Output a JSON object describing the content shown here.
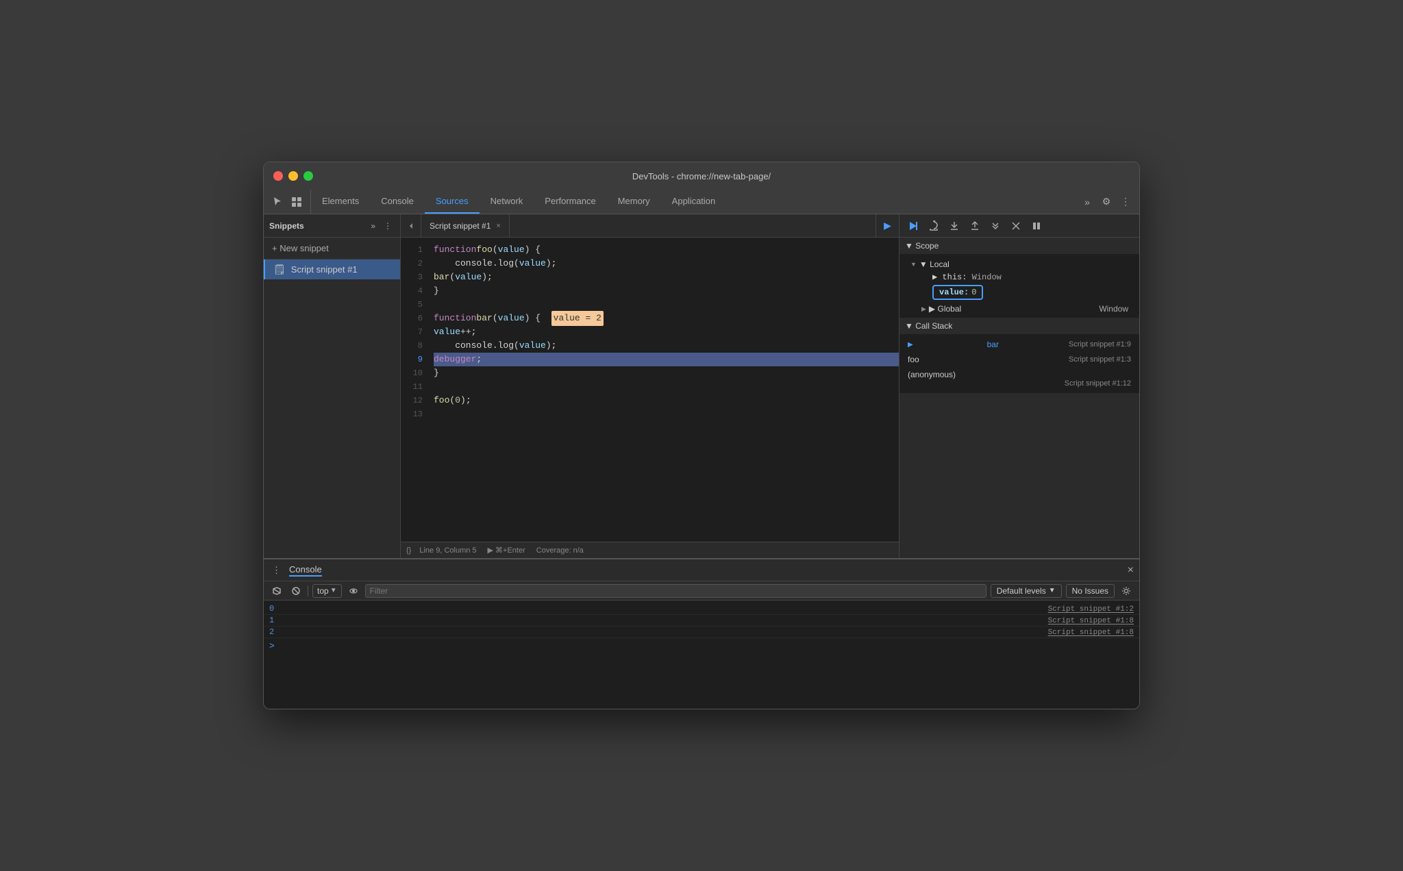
{
  "window": {
    "title": "DevTools - chrome://new-tab-page/"
  },
  "traffic_lights": {
    "red": "close",
    "yellow": "minimize",
    "green": "maximize"
  },
  "tabs": {
    "items": [
      {
        "label": "Elements",
        "active": false
      },
      {
        "label": "Console",
        "active": false
      },
      {
        "label": "Sources",
        "active": true
      },
      {
        "label": "Network",
        "active": false
      },
      {
        "label": "Performance",
        "active": false
      },
      {
        "label": "Memory",
        "active": false
      },
      {
        "label": "Application",
        "active": false
      }
    ],
    "more_label": "»",
    "settings_label": "⚙",
    "more_settings_label": "⋮"
  },
  "sidebar": {
    "title": "Snippets",
    "more_label": "»",
    "menu_label": "⋮",
    "new_snippet_label": "+ New snippet",
    "snippet_item": "Script snippet #1"
  },
  "editor": {
    "nav_back_label": "◀",
    "file_tab_label": "Script snippet #1",
    "file_tab_close_label": "×",
    "run_btn_label": "▶",
    "lines": [
      {
        "num": 1,
        "code": "function foo(value) {",
        "tokens": [
          {
            "type": "kw",
            "text": "function"
          },
          {
            "type": "space",
            "text": " "
          },
          {
            "type": "fn",
            "text": "foo"
          },
          {
            "type": "plain",
            "text": "("
          },
          {
            "type": "param",
            "text": "value"
          },
          {
            "type": "plain",
            "text": ") {"
          }
        ]
      },
      {
        "num": 2,
        "code": "    console.log(value);",
        "tokens": [
          {
            "type": "plain",
            "text": "    console.log("
          },
          {
            "type": "param",
            "text": "value"
          },
          {
            "type": "plain",
            "text": ");"
          }
        ]
      },
      {
        "num": 3,
        "code": "    bar(value);",
        "tokens": [
          {
            "type": "plain",
            "text": "    "
          },
          {
            "type": "fn",
            "text": "bar"
          },
          {
            "type": "plain",
            "text": "("
          },
          {
            "type": "param",
            "text": "value"
          },
          {
            "type": "plain",
            "text": ");"
          }
        ]
      },
      {
        "num": 4,
        "code": "}",
        "tokens": [
          {
            "type": "plain",
            "text": "}"
          }
        ]
      },
      {
        "num": 5,
        "code": "",
        "tokens": []
      },
      {
        "num": 6,
        "code": "function bar(value) {  value = 2",
        "highlight": true,
        "tokens": [
          {
            "type": "kw",
            "text": "function"
          },
          {
            "type": "space",
            "text": " "
          },
          {
            "type": "fn",
            "text": "bar"
          },
          {
            "type": "plain",
            "text": "("
          },
          {
            "type": "param",
            "text": "value"
          },
          {
            "type": "plain",
            "text": ") {  "
          },
          {
            "type": "inline-hl",
            "text": "value = 2"
          }
        ]
      },
      {
        "num": 7,
        "code": "    value++;",
        "tokens": [
          {
            "type": "plain",
            "text": "    "
          },
          {
            "type": "param",
            "text": "value"
          },
          {
            "type": "plain",
            "text": "++;"
          }
        ]
      },
      {
        "num": 8,
        "code": "    console.log(value);",
        "tokens": [
          {
            "type": "plain",
            "text": "    console.log("
          },
          {
            "type": "param",
            "text": "value"
          },
          {
            "type": "plain",
            "text": ");"
          }
        ]
      },
      {
        "num": 9,
        "code": "    debugger;",
        "debugger": true,
        "tokens": [
          {
            "type": "plain",
            "text": "    "
          },
          {
            "type": "kw",
            "text": "debugger"
          },
          {
            "type": "plain",
            "text": ";"
          }
        ]
      },
      {
        "num": 10,
        "code": "}",
        "tokens": [
          {
            "type": "plain",
            "text": "}"
          }
        ]
      },
      {
        "num": 11,
        "code": "",
        "tokens": []
      },
      {
        "num": 12,
        "code": "foo(0);",
        "tokens": [
          {
            "type": "fn",
            "text": "foo"
          },
          {
            "type": "plain",
            "text": "("
          },
          {
            "type": "num",
            "text": "0"
          },
          {
            "type": "plain",
            "text": ");"
          }
        ]
      },
      {
        "num": 13,
        "code": "",
        "tokens": []
      }
    ],
    "status": {
      "format_label": "{}",
      "position": "Line 9, Column 5",
      "run_hint": "▶  ⌘+Enter",
      "coverage": "Coverage: n/a"
    }
  },
  "right_panel": {
    "debug_buttons": [
      "▶",
      "↺",
      "↓",
      "↑",
      "→",
      "✎",
      "⏸"
    ],
    "scope": {
      "section_label": "▼ Scope",
      "local": {
        "label": "▼ Local",
        "this_label": "▶ this:",
        "this_value": "Window",
        "value_key": "value:",
        "value_val": "0",
        "global_label": "▶ Global",
        "global_value": "Window"
      }
    },
    "call_stack": {
      "section_label": "▼ Call Stack",
      "items": [
        {
          "name": "bar",
          "location": "Script snippet #1:9",
          "active": true
        },
        {
          "name": "foo",
          "location": "Script snippet #1:3",
          "active": false
        },
        {
          "name": "(anonymous)",
          "location": "Script snippet #1:12",
          "active": false
        }
      ]
    }
  },
  "console": {
    "menu_label": "⋮",
    "title": "Console",
    "close_label": "×",
    "toolbar": {
      "play_label": "▶",
      "block_label": "⊘",
      "top_label": "top",
      "eye_label": "👁",
      "filter_placeholder": "Filter",
      "default_levels_label": "Default levels",
      "no_issues_label": "No Issues",
      "settings_label": "⚙"
    },
    "output": [
      {
        "value": "0",
        "location": "Script snippet #1:2"
      },
      {
        "value": "1",
        "location": "Script snippet #1:8"
      },
      {
        "value": "2",
        "location": "Script snippet #1:8"
      }
    ],
    "prompt": ">"
  }
}
